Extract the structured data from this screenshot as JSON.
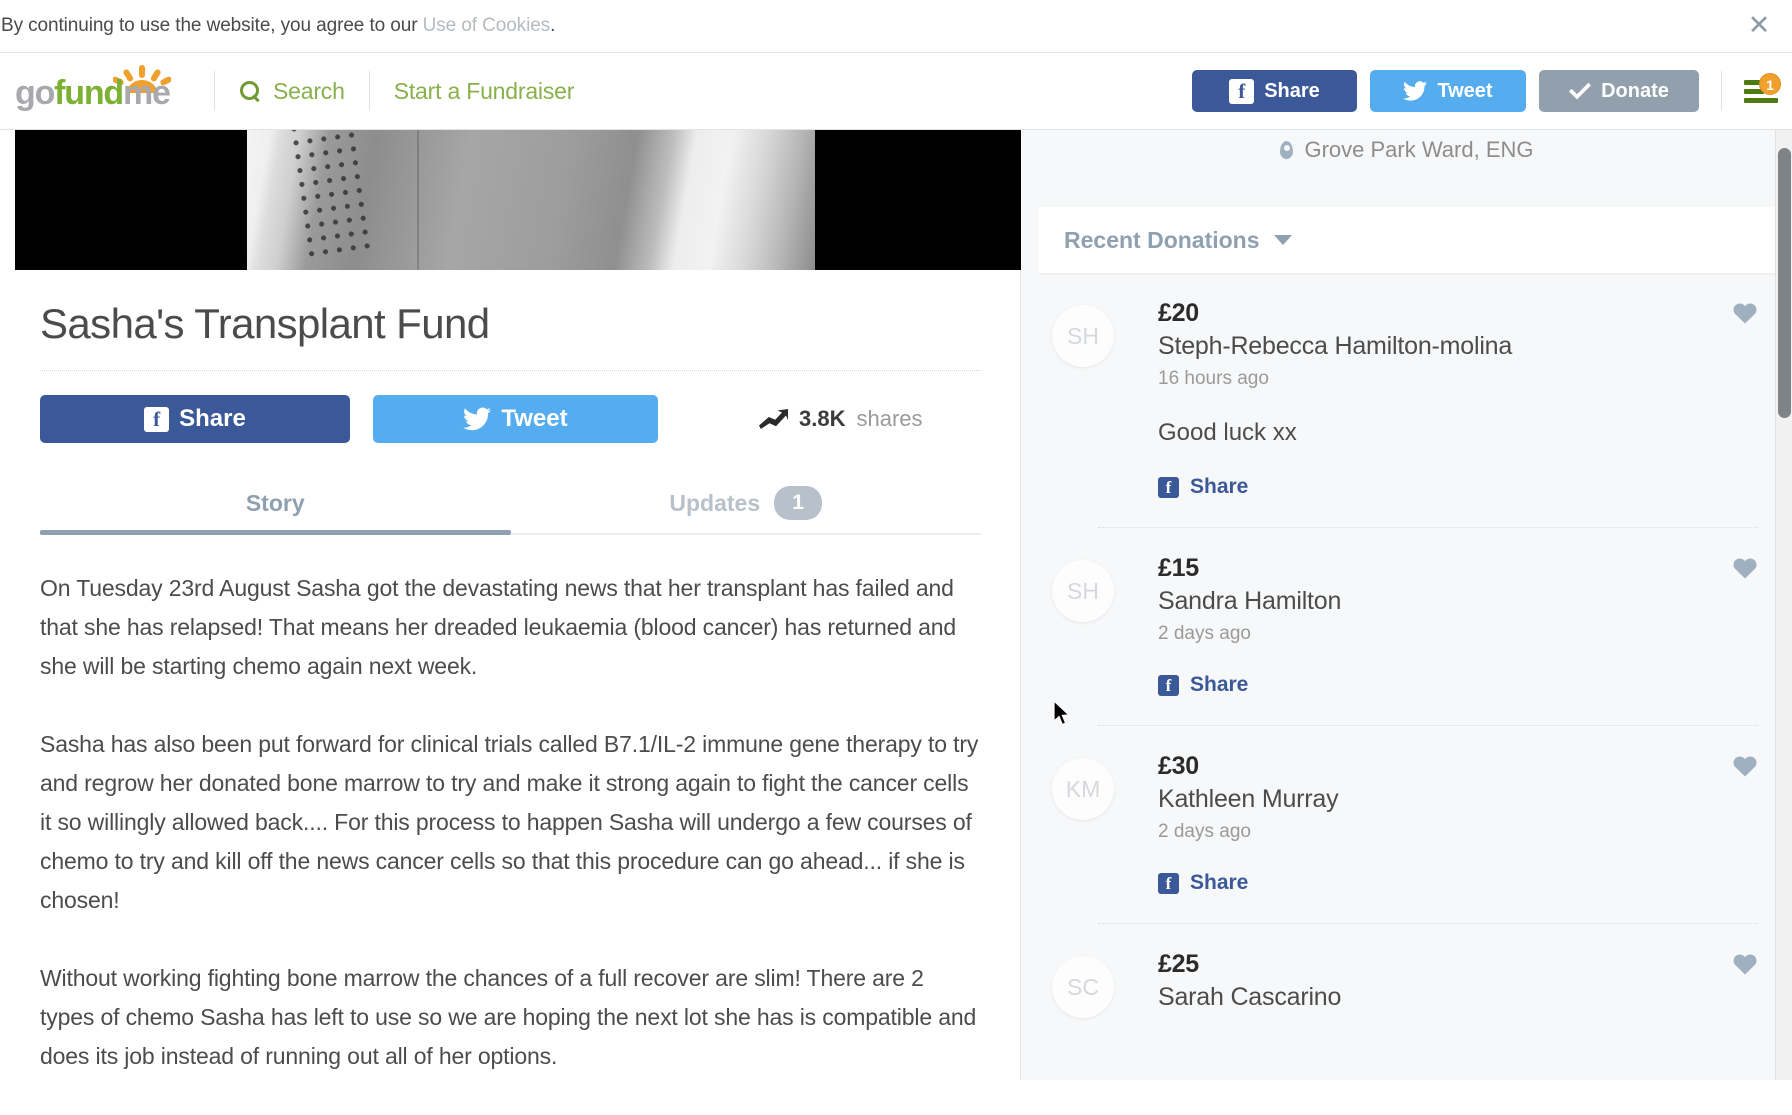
{
  "cookie_bar": {
    "text_before": "By continuing to use the website, you agree to our ",
    "link_text": "Use of Cookies",
    "text_after": ".",
    "close_icon": "close-icon"
  },
  "header": {
    "logo": {
      "part1": "go",
      "part2": "fund",
      "part3": "me"
    },
    "search_label": "Search",
    "start_fundraiser_label": "Start a Fundraiser",
    "share_label": "Share",
    "tweet_label": "Tweet",
    "donate_label": "Donate",
    "menu_badge": "1"
  },
  "campaign": {
    "title": "Sasha's Transplant Fund",
    "share_label": "Share",
    "tweet_label": "Tweet",
    "shares_count": "3.8K",
    "shares_word": "shares",
    "tabs": [
      {
        "label": "Story",
        "active": true
      },
      {
        "label": "Updates",
        "badge": "1",
        "active": false
      }
    ],
    "story_paragraphs": [
      "On Tuesday 23rd August Sasha got the devastating news that her transplant has failed and that she has relapsed! That means her dreaded leukaemia (blood cancer) has returned and she will be starting chemo again next week.",
      "Sasha has also been put forward for clinical trials called B7.1/IL-2 immune gene therapy to try and regrow her donated bone marrow to try and make it strong again to fight the cancer cells it so willingly allowed back.... For this process to happen Sasha will undergo a few courses of chemo to try and kill off the news cancer cells so that this procedure can go ahead... if she is chosen!",
      "Without working fighting bone marrow the chances of a full recover are slim! There are 2 types of chemo Sasha has left to use so we are hoping the next lot she has is compatible and does its job instead of running out all of her options."
    ]
  },
  "sidebar": {
    "location": "Grove Park Ward, ENG",
    "donations_header": "Recent Donations",
    "share_label": "Share",
    "donations": [
      {
        "initials": "SH",
        "amount": "£20",
        "name": "Steph-Rebecca Hamilton-molina",
        "time": "16 hours ago",
        "comment": "Good luck xx"
      },
      {
        "initials": "SH",
        "amount": "£15",
        "name": "Sandra Hamilton",
        "time": "2 days ago",
        "comment": ""
      },
      {
        "initials": "KM",
        "amount": "£30",
        "name": "Kathleen Murray",
        "time": "2 days ago",
        "comment": ""
      },
      {
        "initials": "SC",
        "amount": "£25",
        "name": "Sarah Cascarino",
        "time": "",
        "comment": ""
      }
    ]
  },
  "colors": {
    "facebook_blue": "#3b5998",
    "twitter_blue": "#55acee",
    "donate_grey": "#92a0ae",
    "brand_green": "#88b04b",
    "badge_orange": "#f0a02d"
  }
}
